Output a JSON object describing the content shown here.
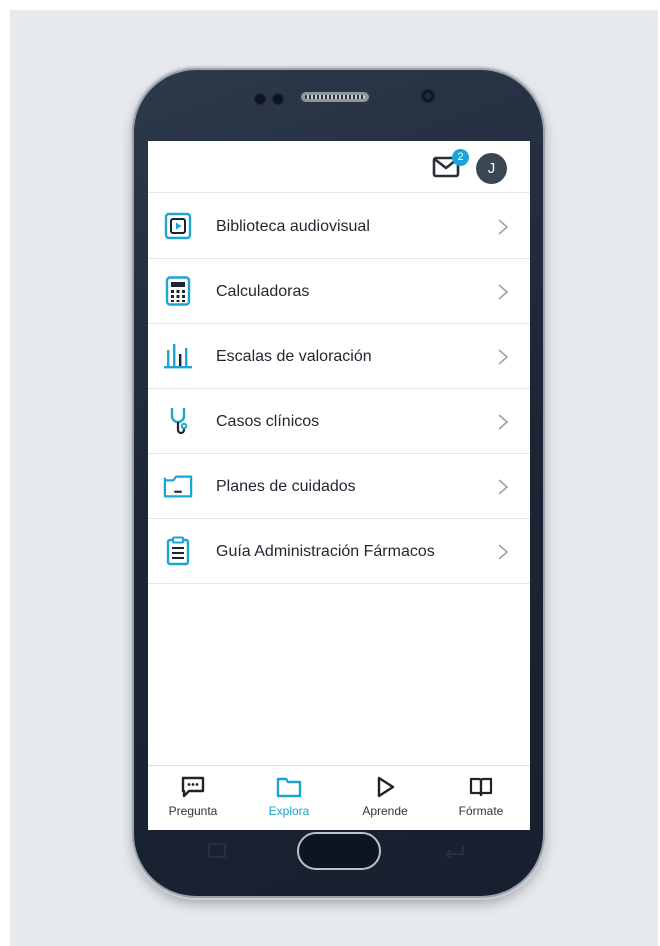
{
  "header": {
    "mail_badge_count": "2",
    "avatar_initial": "J"
  },
  "menu": {
    "items": [
      {
        "label": "Biblioteca audiovisual",
        "icon": "video-library-icon"
      },
      {
        "label": "Calculadoras",
        "icon": "calculator-icon"
      },
      {
        "label": "Escalas de valoración",
        "icon": "bar-chart-icon"
      },
      {
        "label": "Casos clínicos",
        "icon": "stethoscope-icon"
      },
      {
        "label": "Planes de cuidados",
        "icon": "folder-icon"
      },
      {
        "label": "Guía Administración Fármacos",
        "icon": "clipboard-icon"
      }
    ]
  },
  "bottom_nav": {
    "tabs": [
      {
        "label": "Pregunta",
        "icon": "chat-icon",
        "active": false
      },
      {
        "label": "Explora",
        "icon": "folder-icon",
        "active": true
      },
      {
        "label": "Aprende",
        "icon": "play-icon",
        "active": false
      },
      {
        "label": "Fórmate",
        "icon": "book-icon",
        "active": false
      }
    ]
  },
  "colors": {
    "accent": "#1aa5d4",
    "avatar_bg": "#3b4654",
    "background": "#e7eaed",
    "text": "#222831"
  }
}
